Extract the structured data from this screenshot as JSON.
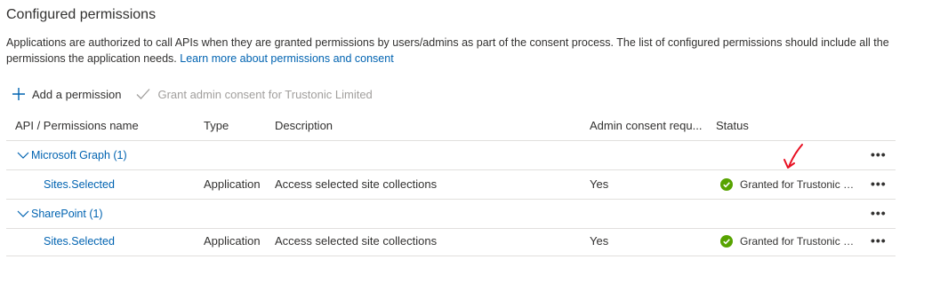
{
  "section": {
    "title": "Configured permissions",
    "description": "Applications are authorized to call APIs when they are granted permissions by users/admins as part of the consent process. The list of configured permissions should include all the permissions the application needs.",
    "learn_more": "Learn more about permissions and consent"
  },
  "toolbar": {
    "add_permission": "Add a permission",
    "grant_consent": "Grant admin consent for Trustonic Limited"
  },
  "table": {
    "headers": {
      "api": "API / Permissions name",
      "type": "Type",
      "description": "Description",
      "admin": "Admin consent requ...",
      "status": "Status"
    },
    "groups": [
      {
        "name": "Microsoft Graph (1)",
        "permissions": [
          {
            "name": "Sites.Selected",
            "type": "Application",
            "description": "Access selected site collections",
            "admin": "Yes",
            "status": "Granted for Trustonic Limited"
          }
        ]
      },
      {
        "name": "SharePoint (1)",
        "permissions": [
          {
            "name": "Sites.Selected",
            "type": "Application",
            "description": "Access selected site collections",
            "admin": "Yes",
            "status": "Granted for Trustonic Limited"
          }
        ]
      }
    ],
    "more_label": "•••"
  },
  "colors": {
    "link": "#0063b1",
    "success": "#57a300",
    "annotation": "#e81123",
    "border": "#e1dfdd"
  }
}
